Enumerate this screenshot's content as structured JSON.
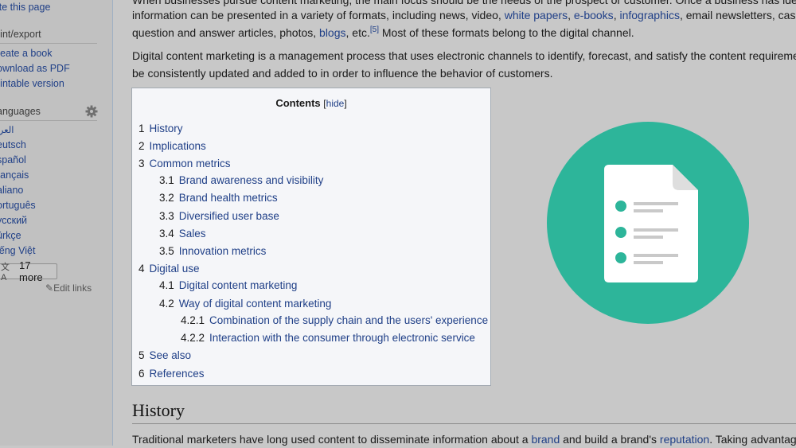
{
  "sidebar": {
    "tools_items": [
      {
        "label": "ite this page"
      }
    ],
    "print_export": {
      "heading": "rint/export",
      "items": [
        {
          "label": "reate a book"
        },
        {
          "label": "ownload as PDF"
        },
        {
          "label": "rintable version"
        }
      ]
    },
    "languages": {
      "heading": "anguages",
      "settings_icon": "gear-icon",
      "items": [
        {
          "label": "العربية"
        },
        {
          "label": "eutsch"
        },
        {
          "label": "spañol"
        },
        {
          "label": "rançais"
        },
        {
          "label": "aliano"
        },
        {
          "label": "ortuguês"
        },
        {
          "label": "усский"
        },
        {
          "label": "ürkçe"
        },
        {
          "label": "iếng Việt"
        }
      ],
      "more_button": {
        "icon": "translate-icon",
        "icon_glyph": "文A",
        "label": "17 more"
      },
      "edit_links": {
        "icon": "pencil-icon",
        "label": "Edit links"
      }
    }
  },
  "content": {
    "para1": {
      "line0": "When businesses pursue content marketing, the main focus should be the needs of the prospect or customer. Once a business has ide",
      "line1_a": "information can be presented in a variety of formats, including news, video, ",
      "link_white_papers": "white papers",
      "sep1": ", ",
      "link_ebooks": "e-books",
      "sep2": ", ",
      "link_infographics": "infographics",
      "line1_b": ", email newsletters, cas",
      "line2_a": "question and answer articles, photos, ",
      "link_blogs": "blogs",
      "line2_b": ", etc.",
      "ref": "[5]",
      "line2_c": " Most of these formats belong to the digital channel."
    },
    "para2": {
      "line1": "Digital content marketing is a management process that uses electronic channels to identify, forecast, and satisfy the content requireme",
      "line2": "be consistently updated and added to in order to influence the behavior of customers."
    },
    "toc": {
      "title": "Contents",
      "hide_open": "[",
      "hide_label": "hide",
      "hide_close": "]",
      "items": [
        {
          "num": "1",
          "label": "History",
          "level": 1
        },
        {
          "num": "2",
          "label": "Implications",
          "level": 1
        },
        {
          "num": "3",
          "label": "Common metrics",
          "level": 1
        },
        {
          "num": "3.1",
          "label": "Brand awareness and visibility",
          "level": 2
        },
        {
          "num": "3.2",
          "label": "Brand health metrics",
          "level": 2
        },
        {
          "num": "3.3",
          "label": "Diversified user base",
          "level": 2
        },
        {
          "num": "3.4",
          "label": "Sales",
          "level": 2
        },
        {
          "num": "3.5",
          "label": "Innovation metrics",
          "level": 2
        },
        {
          "num": "4",
          "label": "Digital use",
          "level": 1
        },
        {
          "num": "4.1",
          "label": "Digital content marketing",
          "level": 2
        },
        {
          "num": "4.2",
          "label": "Way of digital content marketing",
          "level": 2
        },
        {
          "num": "4.2.1",
          "label": "Combination of the supply chain and the users' experience",
          "level": 3
        },
        {
          "num": "4.2.2",
          "label": "Interaction with the consumer through electronic service",
          "level": 3
        },
        {
          "num": "5",
          "label": "See also",
          "level": 1
        },
        {
          "num": "6",
          "label": "References",
          "level": 1
        }
      ]
    },
    "illustration": {
      "icon": "document-list-icon",
      "circle_color": "#2db59a"
    },
    "history": {
      "heading": "History",
      "line1_a": "Traditional marketers have long used content to disseminate information about a ",
      "link_brand": "brand",
      "line1_b": " and build a brand's ",
      "link_reputation": "reputation",
      "line1_c": ". Taking advantag"
    }
  },
  "colors": {
    "link": "#1f3f87",
    "page_bg": "#c8c8c8",
    "sidebar_bg": "#c1c1c1",
    "toc_bg": "#f5f6f9",
    "accent_teal": "#2db59a"
  }
}
